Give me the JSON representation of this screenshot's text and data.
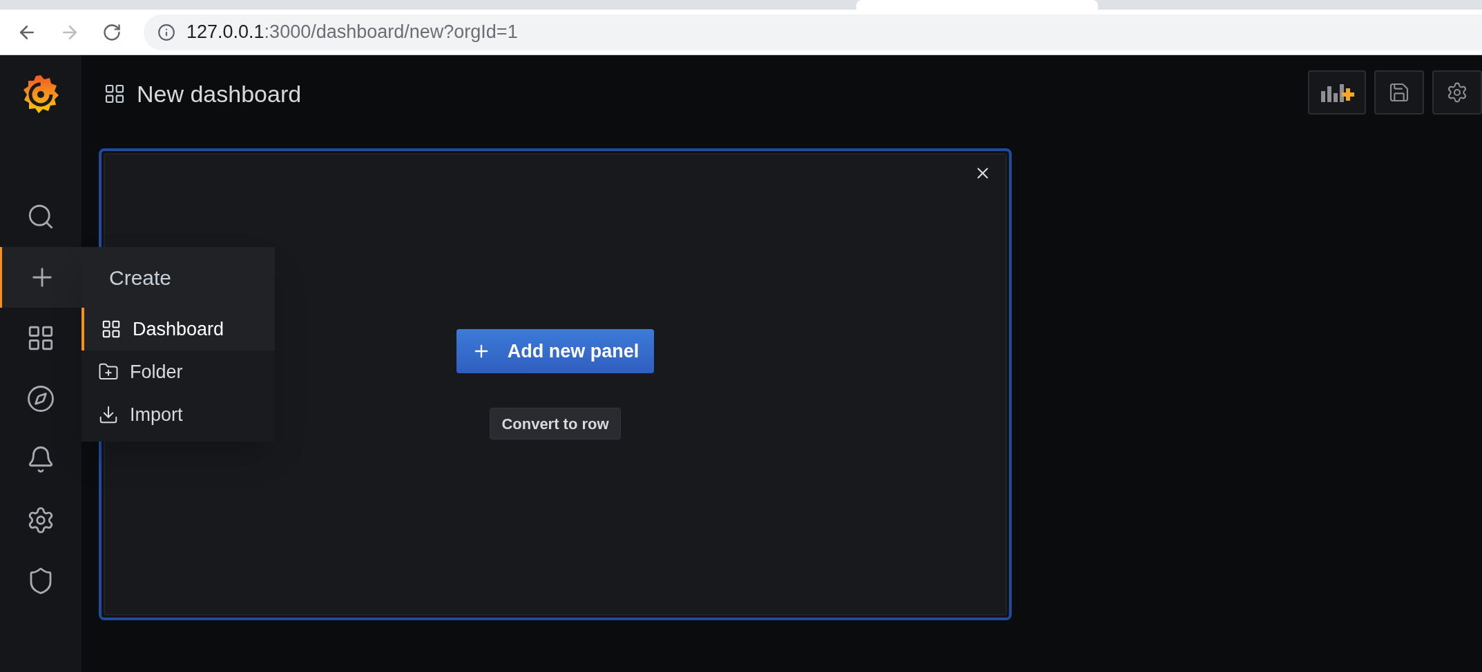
{
  "browser": {
    "url_host": "127.0.0.1",
    "url_path": ":3000/dashboard/new?orgId=1"
  },
  "sidebar": {
    "items": [
      {
        "selected": false
      },
      {
        "selected": true
      },
      {
        "selected": false
      },
      {
        "selected": false
      },
      {
        "selected": false
      },
      {
        "selected": false
      },
      {
        "selected": false
      }
    ]
  },
  "create_menu": {
    "title": "Create",
    "items": [
      {
        "label": "Dashboard",
        "selected": true
      },
      {
        "label": "Folder",
        "selected": false
      },
      {
        "label": "Import",
        "selected": false
      }
    ]
  },
  "header": {
    "title": "New dashboard"
  },
  "panel": {
    "add_button": "Add new panel",
    "convert_button": "Convert to row"
  }
}
